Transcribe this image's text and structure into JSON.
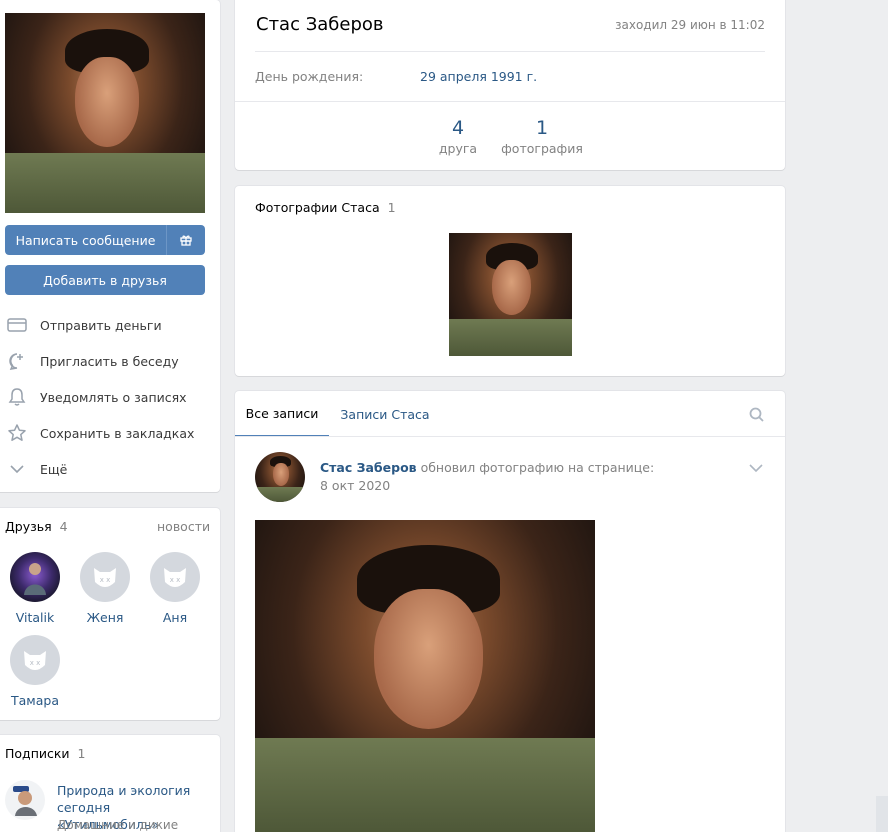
{
  "profile": {
    "name": "Стас Заберов",
    "last_seen": "заходил 29 июн в 11:02",
    "birthday_label": "День рождения:",
    "birthday_value": "29 апреля 1991 г.",
    "counters": [
      {
        "value": "4",
        "label": "друга"
      },
      {
        "value": "1",
        "label": "фотография"
      }
    ]
  },
  "actions": {
    "message": "Написать сообщение",
    "add_friend": "Добавить в друзья",
    "menu": [
      {
        "icon": "card-icon",
        "label": "Отправить деньги"
      },
      {
        "icon": "chat-plus-icon",
        "label": "Пригласить в беседу"
      },
      {
        "icon": "bell-icon",
        "label": "Уведомлять о записях"
      },
      {
        "icon": "star-icon",
        "label": "Сохранить в закладках"
      },
      {
        "icon": "chevron-down-icon",
        "label": "Ещё"
      }
    ]
  },
  "friends": {
    "title": "Друзья",
    "count": "4",
    "news_link": "новости",
    "items": [
      {
        "name": "Vitalik"
      },
      {
        "name": "Женя"
      },
      {
        "name": "Аня"
      },
      {
        "name": "Тамара"
      }
    ]
  },
  "subscriptions": {
    "title": "Подписки",
    "count": "1",
    "item_name": "Природа и экология сегодня «Утильмобиль»",
    "item_sub": "Домашние и дикие"
  },
  "photos": {
    "title": "Фотографии Стаса",
    "count": "1"
  },
  "wall": {
    "tabs": [
      "Все записи",
      "Записи Стаса"
    ],
    "post": {
      "author": "Стас Заберов",
      "action": "обновил фотографию на странице:",
      "date": "8 окт 2020"
    }
  },
  "colors": {
    "accent": "#5181b8",
    "link": "#2a5885",
    "background": "#edeef0"
  }
}
